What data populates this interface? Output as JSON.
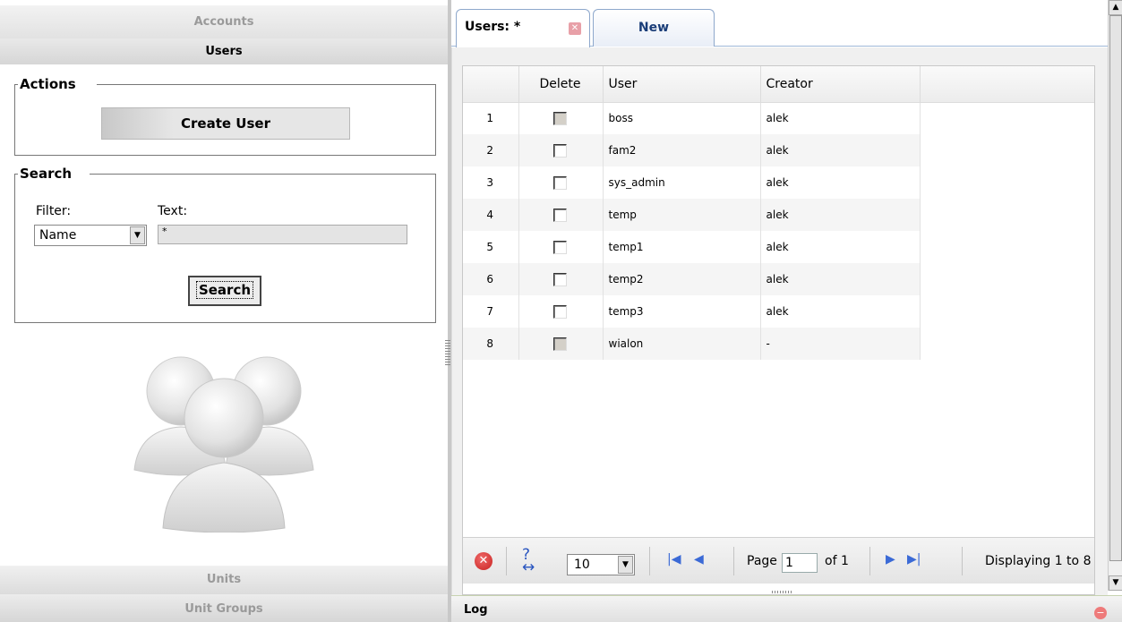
{
  "sidebar": {
    "accordion": {
      "accounts": "Accounts",
      "users": "Users",
      "units": "Units",
      "unit_groups": "Unit Groups"
    },
    "actions": {
      "legend": "Actions",
      "create_user_label": "Create User"
    },
    "search": {
      "legend": "Search",
      "filter_label": "Filter:",
      "text_label": "Text:",
      "filter_value": "Name",
      "text_value": "*",
      "search_button_label": "Search"
    }
  },
  "tabs": [
    {
      "label": "Users: *",
      "active": true
    },
    {
      "label": "New",
      "active": false
    }
  ],
  "grid": {
    "columns": [
      "Delete",
      "User",
      "Creator"
    ],
    "rows": [
      {
        "num": "1",
        "user": "boss",
        "creator": "alek",
        "checkbox_enabled": false
      },
      {
        "num": "2",
        "user": "fam2",
        "creator": "alek",
        "checkbox_enabled": true
      },
      {
        "num": "3",
        "user": "sys_admin",
        "creator": "alek",
        "checkbox_enabled": true
      },
      {
        "num": "4",
        "user": "temp",
        "creator": "alek",
        "checkbox_enabled": true
      },
      {
        "num": "5",
        "user": "temp1",
        "creator": "alek",
        "checkbox_enabled": true
      },
      {
        "num": "6",
        "user": "temp2",
        "creator": "alek",
        "checkbox_enabled": true
      },
      {
        "num": "7",
        "user": "temp3",
        "creator": "alek",
        "checkbox_enabled": true
      },
      {
        "num": "8",
        "user": "wialon",
        "creator": "-",
        "checkbox_enabled": false
      }
    ]
  },
  "pager": {
    "page_size": "10",
    "page_label": "Page",
    "page_value": "1",
    "of_label": "of 1",
    "display_text": "Displaying 1 to 8"
  },
  "log": {
    "label": "Log"
  },
  "colors": {
    "accent_tab_text": "#1a3d78",
    "nav_icon_blue": "#3b6ad6",
    "cancel_red": "#c8211f"
  },
  "icons": {
    "cancel": "cancel-icon",
    "resize_columns": "resize-columns-icon",
    "first_page": "first-page-icon",
    "prev_page": "prev-page-icon",
    "next_page": "next-page-icon",
    "last_page": "last-page-icon",
    "users_illustration": "users-group-icon",
    "tab_close": "close-icon",
    "log_collapse": "collapse-icon"
  }
}
